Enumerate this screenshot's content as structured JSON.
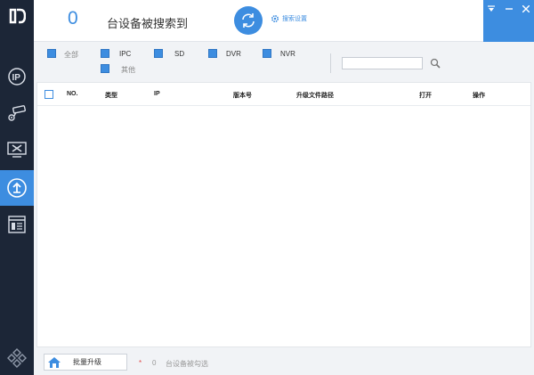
{
  "header": {
    "device_count": "0",
    "found_text": "台设备被搜索到",
    "search_settings_label": "搜索设置"
  },
  "filters": [
    {
      "label": "全部",
      "checked": true,
      "muted": true
    },
    {
      "label": "IPC",
      "checked": true
    },
    {
      "label": "SD",
      "checked": true
    },
    {
      "label": "DVR",
      "checked": true
    },
    {
      "label": "NVR",
      "checked": true
    },
    {
      "label": "其他",
      "checked": true,
      "muted": true
    }
  ],
  "search": {
    "value": "",
    "placeholder": ""
  },
  "table": {
    "columns": [
      "NO.",
      "类型",
      "IP",
      "版本号",
      "升级文件路径",
      "打开",
      "操作"
    ],
    "rows": []
  },
  "footer": {
    "batch_upgrade_label": "批量升级",
    "required_mark": "*",
    "selected_count": "0",
    "selected_text": "台设备被勾选"
  },
  "colors": {
    "accent": "#3d8de0",
    "sidebar": "#1c2637"
  },
  "icons": {
    "logo": "brand-logo-icon",
    "nav": [
      "ip-icon",
      "camera-config-icon",
      "tools-icon",
      "upgrade-icon",
      "list-icon"
    ],
    "bottom": "plugins-icon"
  }
}
